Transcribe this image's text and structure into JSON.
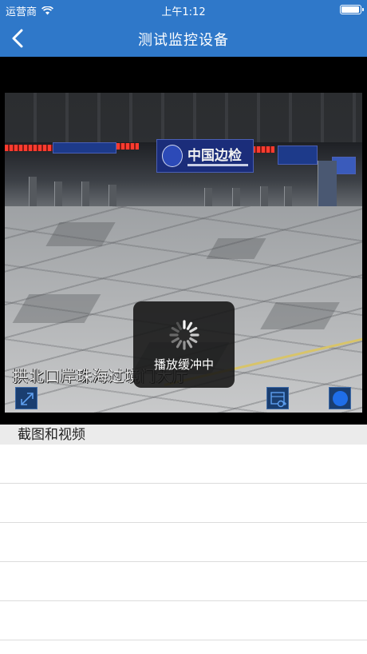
{
  "status_bar": {
    "carrier": "运营商",
    "time": "上午1:12"
  },
  "nav": {
    "title": "测试监控设备",
    "back_icon": "chevron-left-icon"
  },
  "player": {
    "buffering_text": "播放缓冲中",
    "overlay_caption": "拱北口岸珠海过境门大厅",
    "sign_text": "中国边检",
    "icons": [
      "fullscreen-icon",
      "snapshot-icon",
      "record-icon"
    ],
    "accent_color": "#2f78c9",
    "record_color": "#1f6ee8"
  },
  "section": {
    "title": "截图和视频"
  },
  "list": {
    "rows": [
      "",
      "",
      "",
      "",
      ""
    ]
  }
}
